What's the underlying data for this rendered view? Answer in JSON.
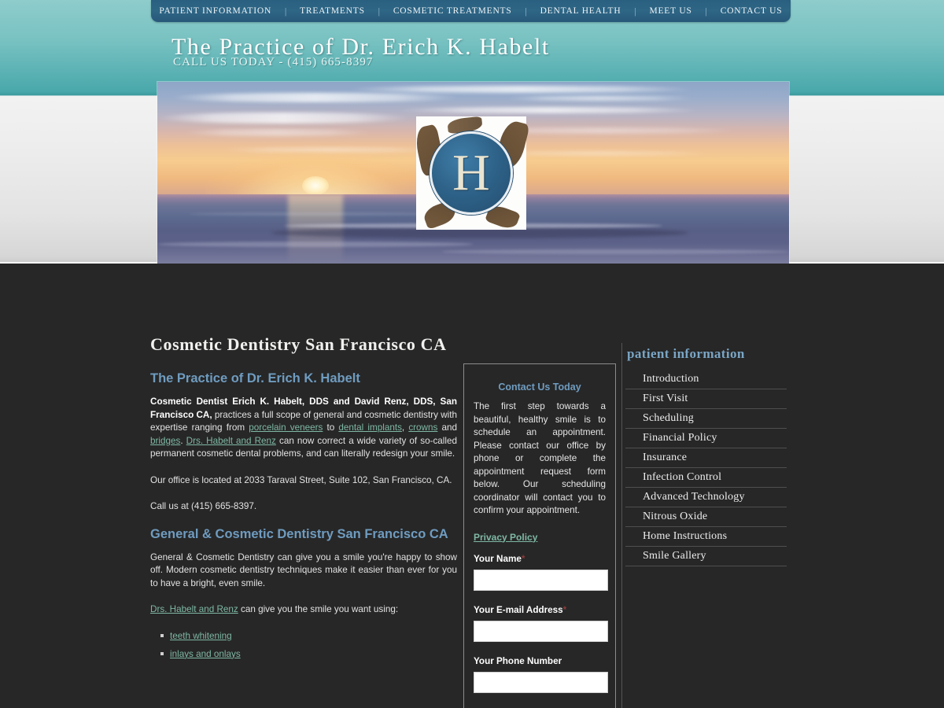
{
  "nav": {
    "items": [
      {
        "label": "PATIENT INFORMATION"
      },
      {
        "label": "TREATMENTS"
      },
      {
        "label": "COSMETIC TREATMENTS"
      },
      {
        "label": "DENTAL HEALTH"
      },
      {
        "label": "MEET US"
      },
      {
        "label": "CONTACT US"
      }
    ],
    "separator": "|"
  },
  "header": {
    "title": "The Practice of Dr. Erich K. Habelt",
    "tagline": "CALL US TODAY - (415) 665-8397",
    "logo_letter": "H"
  },
  "main": {
    "page_title": "Cosmetic Dentistry  San Francisco  CA",
    "heading1": "The Practice of Dr. Erich K. Habelt",
    "p1": {
      "bold": "Cosmetic Dentist Erich K. Habelt, DDS and David Renz, DDS, San Francisco CA,",
      "t1": " practices a full scope of general and cosmetic dentistry with expertise ranging from ",
      "link1": "porcelain veneers",
      "t2": " to ",
      "link2": "dental implants",
      "t3": ", ",
      "link3": "crowns",
      "t4": " and ",
      "link4": "bridges",
      "t5": ". ",
      "link5": "Drs. Habelt and Renz",
      "t6": " can now correct a wide variety of so-called permanent cosmetic dental problems, and can literally redesign your smile."
    },
    "p2": "Our office is located at 2033 Taraval Street, Suite 102, San Francisco, CA.",
    "p3": "Call us at (415) 665-8397.",
    "heading2": "General & Cosmetic Dentistry San Francisco CA",
    "p4": "General & Cosmetic Dentistry can give you a smile you're happy to show off. Modern cosmetic dentistry techniques make it easier than ever for you to have a bright, even smile.",
    "p5": {
      "link": "Drs. Habelt and Renz",
      "text": " can give you the smile you want using:"
    },
    "bullets": [
      {
        "label": "teeth whitening"
      },
      {
        "label": "inlays and onlays"
      }
    ]
  },
  "contact": {
    "title": "Contact Us Today",
    "body": "The first step towards a beautiful, healthy smile is to schedule an appointment. Please contact our office by phone or complete the appointment request form below. Our scheduling coordinator will contact you to confirm your appointment.",
    "privacy_link": "Privacy Policy",
    "fields": [
      {
        "label": "Your Name",
        "required": "*",
        "value": "",
        "placeholder": ""
      },
      {
        "label": "Your E-mail Address",
        "required": "*",
        "value": "",
        "placeholder": ""
      },
      {
        "label": "Your Phone Number",
        "required": "",
        "value": "",
        "placeholder": ""
      }
    ]
  },
  "sidebar": {
    "title": "patient information",
    "items": [
      {
        "label": "Introduction"
      },
      {
        "label": "First Visit"
      },
      {
        "label": "Scheduling"
      },
      {
        "label": "Financial Policy"
      },
      {
        "label": "Insurance"
      },
      {
        "label": "Infection Control"
      },
      {
        "label": "Advanced Technology"
      },
      {
        "label": "Nitrous Oxide"
      },
      {
        "label": "Home Instructions"
      },
      {
        "label": "Smile Gallery"
      }
    ]
  },
  "colors": {
    "banner_teal": "#79c2c2",
    "nav_blue": "#2e6685",
    "accent_heading": "#6f9cc0",
    "link_green": "#7fb8a4",
    "page_dark": "#272727"
  }
}
